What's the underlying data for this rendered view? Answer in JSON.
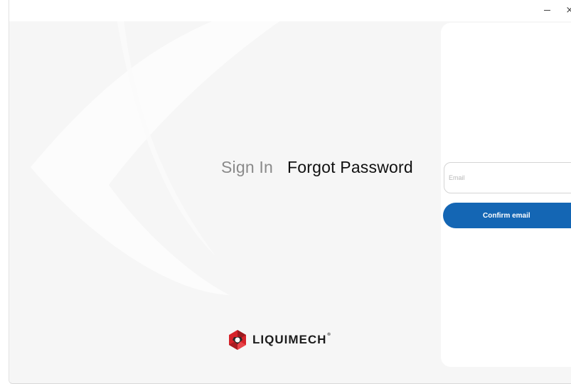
{
  "window": {
    "minimize_label": "–",
    "close_label": "×"
  },
  "tabs": [
    {
      "label": "Sign In",
      "active": false
    },
    {
      "label": "Forgot Password",
      "active": true
    }
  ],
  "form": {
    "email_placeholder": "Email",
    "email_value": "",
    "confirm_label": "Confirm email"
  },
  "brand": {
    "name": "LIQUIMECH",
    "registered_mark": "®",
    "icon": "liquimech-hexagon-logo-icon"
  },
  "colors": {
    "accent": "#1466b4",
    "logo_red": "#d6232a",
    "logo_dark_red": "#9c1a1f",
    "background": "#f6f6f6"
  }
}
